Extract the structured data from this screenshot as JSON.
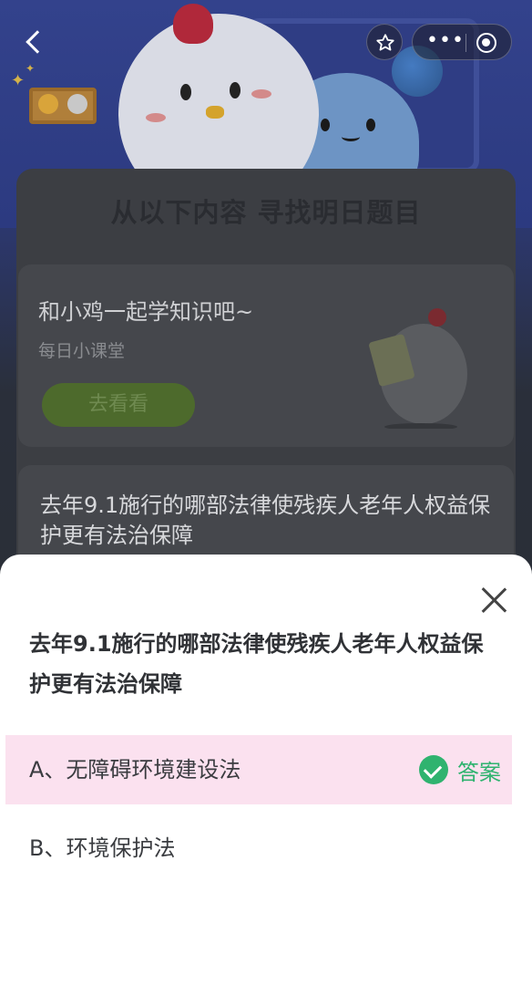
{
  "header": {
    "back_label": "‹",
    "more_label": "•••"
  },
  "page": {
    "section_title": "从以下内容 寻找明日题目",
    "learn_card": {
      "title": "和小鸡一起学知识吧~",
      "subtitle": "每日小课堂",
      "button": "去看看"
    },
    "question_card": {
      "text": "去年9.1施行的哪部法律使残疾人老年人权益保护更有法治保障"
    }
  },
  "sheet": {
    "question": "去年9.1施行的哪部法律使残疾人老年人权益保护更有法治保障",
    "options": [
      {
        "label": "A、无障碍环境建设法",
        "is_answer": true
      },
      {
        "label": "B、环境保护法",
        "is_answer": false
      }
    ],
    "answer_badge": "答案"
  },
  "colors": {
    "answer_green": "#2fb36f",
    "highlight_pink": "#fbe1ef"
  },
  "icons": {
    "back": "back-arrow-icon",
    "favorite": "star-icon",
    "more": "more-dots-icon",
    "miniprogram": "target-icon",
    "close": "close-icon",
    "answer": "check-circle-icon"
  }
}
